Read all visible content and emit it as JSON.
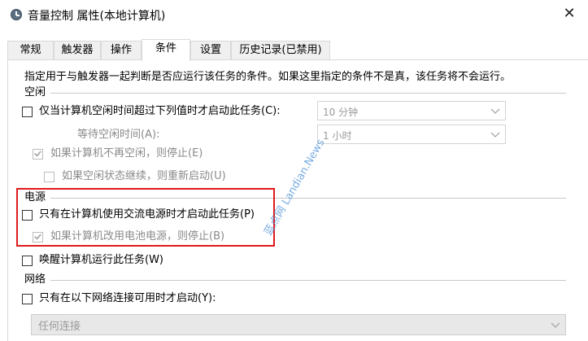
{
  "window": {
    "title": "音量控制 属性(本地计算机)",
    "close_glyph": "✕"
  },
  "tabs": [
    {
      "label": "常规"
    },
    {
      "label": "触发器"
    },
    {
      "label": "操作"
    },
    {
      "label": "条件",
      "active": true
    },
    {
      "label": "设置"
    },
    {
      "label": "历史记录(已禁用)"
    }
  ],
  "description": "指定用于与触发器一起判断是否应运行该任务的条件。如果这里指定的条件不是真，该任务将不会运行。",
  "idle": {
    "group_label": "空闲",
    "start_if_idle": {
      "label": "仅当计算机空闲时间超过下列值时才启动此任务(C):",
      "checked": false
    },
    "idle_duration": {
      "value": "10 分钟"
    },
    "wait_label": "等待空闲时间(A):",
    "wait_value": {
      "value": "1 小时"
    },
    "stop_if_not_idle": {
      "label": "如果计算机不再空闲，则停止(E)",
      "checked": true,
      "enabled": false
    },
    "restart_if_idle": {
      "label": "如果空闲状态继续，则重新启动(U)",
      "checked": false,
      "enabled": false
    }
  },
  "power": {
    "group_label": "电源",
    "ac_only": {
      "label": "只有在计算机使用交流电源时才启动此任务(P)",
      "checked": false
    },
    "stop_on_battery": {
      "label": "如果计算机改用电池电源，则停止(B)",
      "checked": true,
      "enabled": false
    },
    "wake": {
      "label": "唤醒计算机运行此任务(W)",
      "checked": false
    }
  },
  "network": {
    "group_label": "网络",
    "only_if_network": {
      "label": "只有在以下网络连接可用时才启动(Y):",
      "checked": false
    },
    "connection": {
      "value": "任何连接"
    }
  },
  "watermark": {
    "text": "蓝点网 Landian.News",
    "color": "#4a8fd8"
  },
  "colors": {
    "highlight_border": "#e0191c",
    "disabled_text": "#8a8a8a"
  }
}
